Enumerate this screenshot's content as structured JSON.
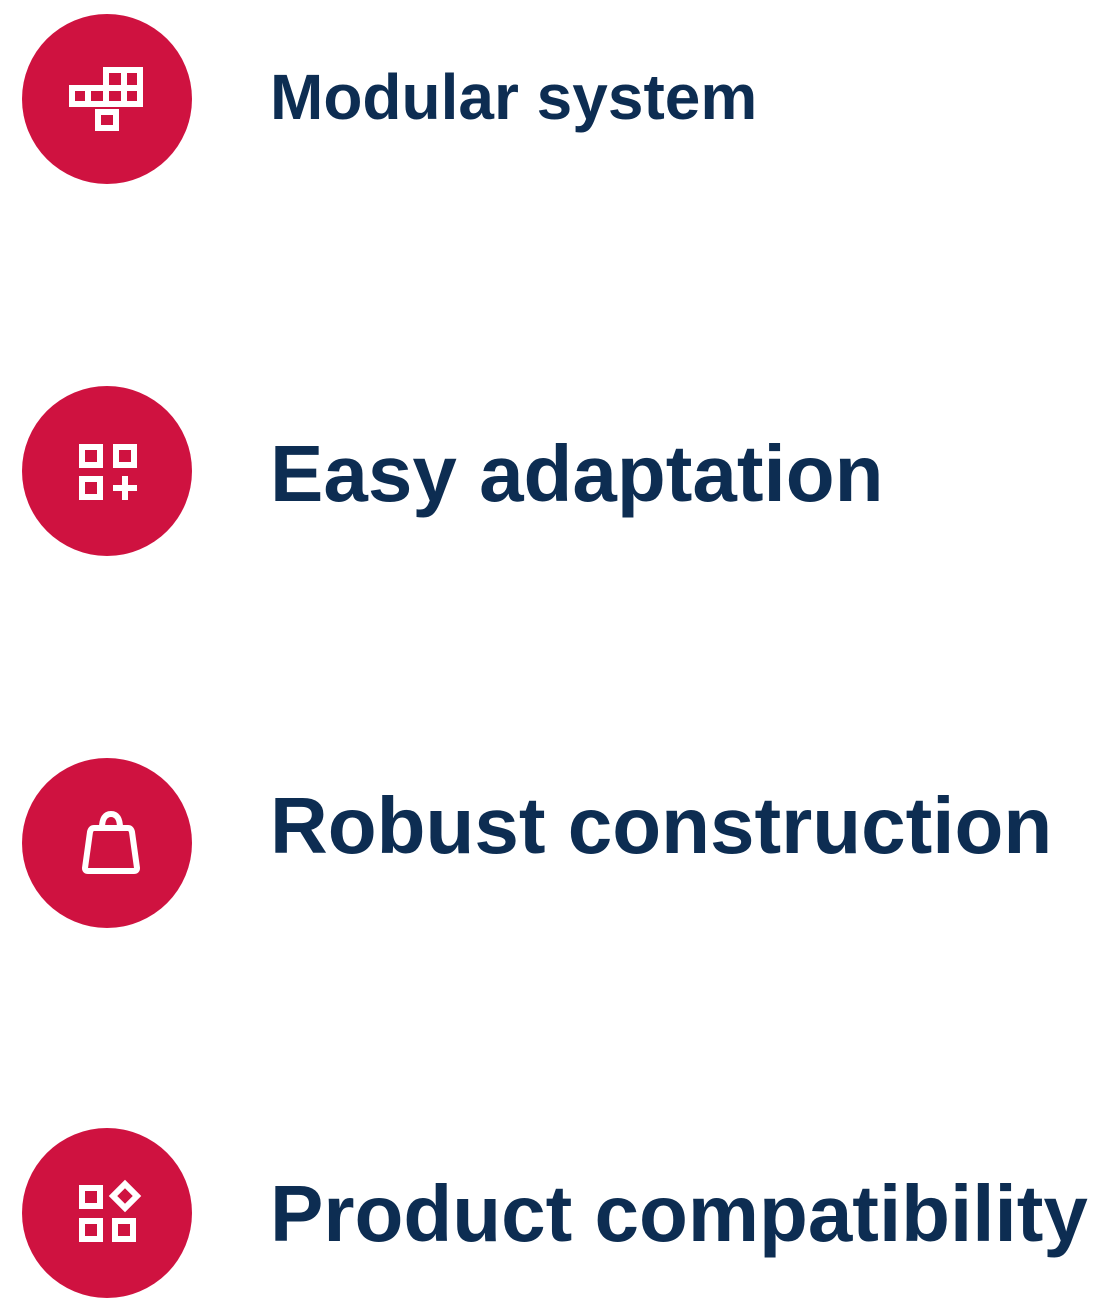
{
  "colors": {
    "badge": "#cf1240",
    "icon": "#ffffff",
    "text": "#0d2d52"
  },
  "features": [
    {
      "label": "Modular system",
      "icon": "modular-blocks-icon"
    },
    {
      "label": "Easy adaptation",
      "icon": "grid-plus-icon"
    },
    {
      "label": "Robust construction",
      "icon": "weight-icon"
    },
    {
      "label": "Product compatibility",
      "icon": "grid-diamond-icon"
    }
  ]
}
